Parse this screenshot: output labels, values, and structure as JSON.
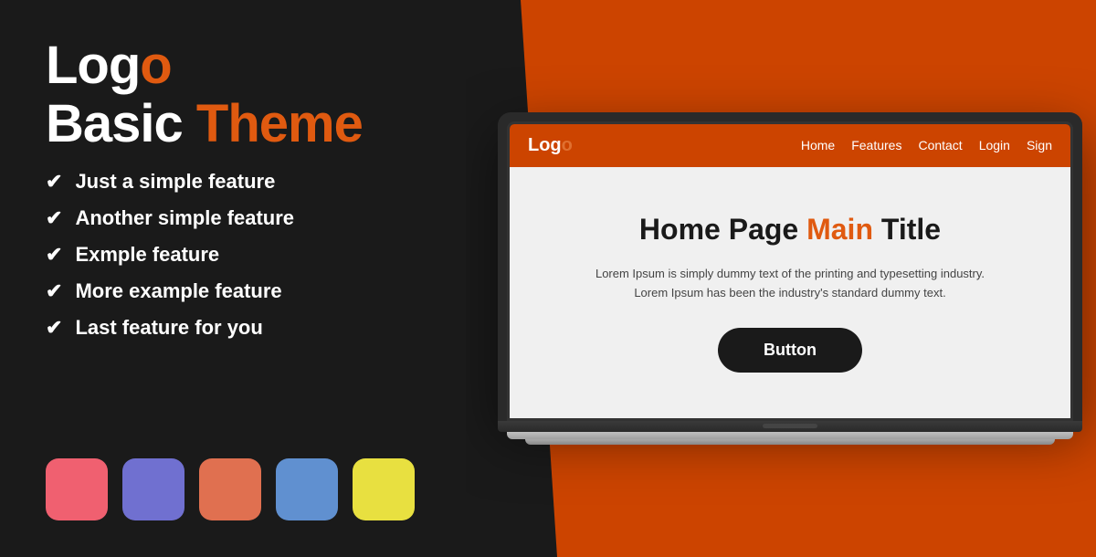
{
  "left": {
    "logo_white": "Logo",
    "logo_orange": "o",
    "subtitle_white": "Basic ",
    "subtitle_orange": "Theme",
    "features": [
      {
        "id": "feature-1",
        "text": "Just a simple feature"
      },
      {
        "id": "feature-2",
        "text": "Another simple feature"
      },
      {
        "id": "feature-3",
        "text": "Exmple feature"
      },
      {
        "id": "feature-4",
        "text": "More example feature"
      },
      {
        "id": "feature-5",
        "text": "Last feature for you"
      }
    ],
    "swatches": [
      {
        "id": "pink",
        "class": "swatch-pink"
      },
      {
        "id": "purple",
        "class": "swatch-purple"
      },
      {
        "id": "coral",
        "class": "swatch-coral"
      },
      {
        "id": "blue",
        "class": "swatch-blue"
      },
      {
        "id": "yellow",
        "class": "swatch-yellow"
      }
    ]
  },
  "website": {
    "logo_white": "Log",
    "logo_orange": "o",
    "nav": [
      "Home",
      "Features",
      "Contact",
      "Login",
      "Sign"
    ],
    "title_black": "Home Page ",
    "title_orange": "Main",
    "title_black2": " Title",
    "description": "Lorem Ipsum is simply dummy text of the printing and typesetting industry.\nLorem Ipsum has been the industry's standard dummy text.",
    "button_label": "Button"
  }
}
